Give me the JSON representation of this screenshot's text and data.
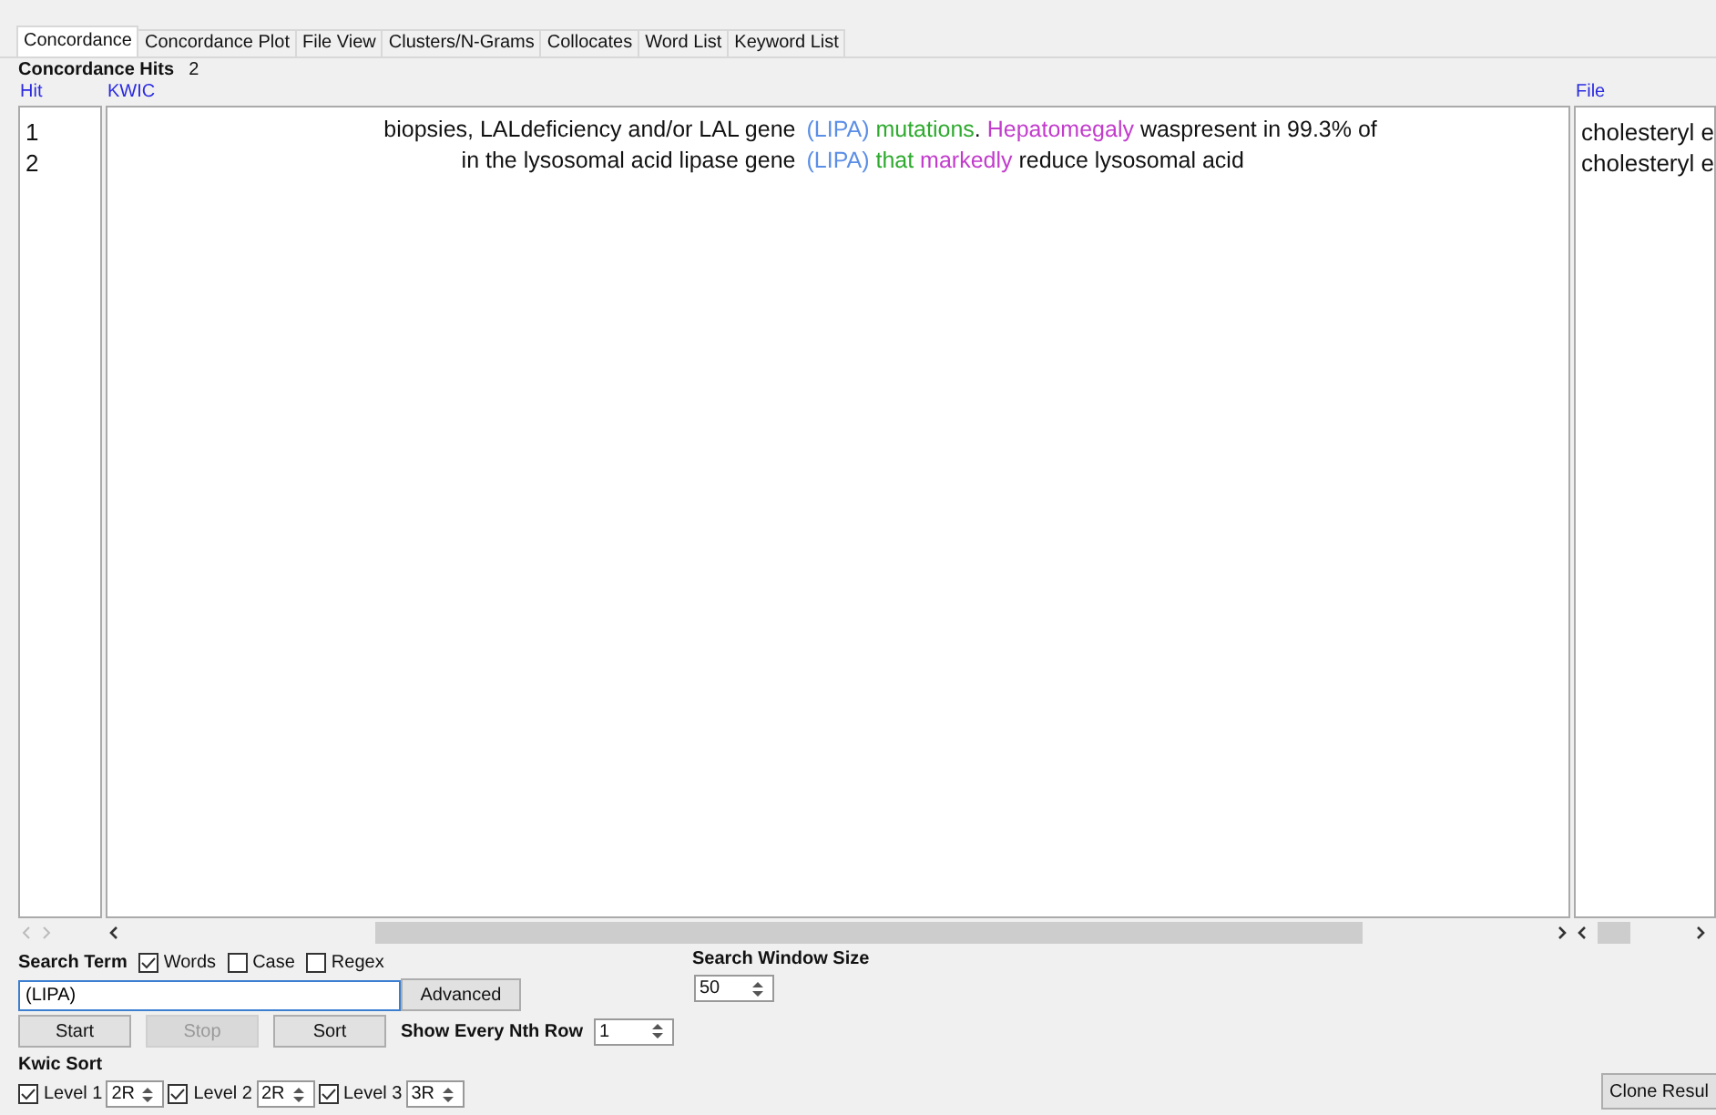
{
  "tabs": [
    {
      "label": "Concordance",
      "selected": true
    },
    {
      "label": "Concordance Plot",
      "selected": false
    },
    {
      "label": "File View",
      "selected": false
    },
    {
      "label": "Clusters/N-Grams",
      "selected": false
    },
    {
      "label": "Collocates",
      "selected": false
    },
    {
      "label": "Word List",
      "selected": false
    },
    {
      "label": "Keyword List",
      "selected": false
    }
  ],
  "hits": {
    "label": "Concordance Hits",
    "count": "2"
  },
  "table": {
    "columns": [
      "Hit",
      "KWIC",
      "File"
    ],
    "rows": [
      {
        "hit": "1",
        "left": "biopsies, LALdeficiency and/or LAL gene",
        "key": {
          "text": "(LIPA)",
          "color": "#5b8ee6"
        },
        "right": [
          {
            "text": " mutations",
            "color": "#2eaa2e"
          },
          {
            "text": "."
          },
          {
            "text": " Hepatomegaly",
            "color": "#c23ccc"
          },
          {
            "text": " waspresent in 99.3% of"
          }
        ],
        "file": "cholesteryl e"
      },
      {
        "hit": "2",
        "left": "in the lysosomal acid lipase gene",
        "key": {
          "text": "(LIPA)",
          "color": "#5b8ee6"
        },
        "right": [
          {
            "text": " that",
            "color": "#2eaa2e"
          },
          {
            "text": " markedly",
            "color": "#c23ccc"
          },
          {
            "text": " reduce lysosomal acid"
          }
        ],
        "file": "cholesteryl e"
      }
    ]
  },
  "search": {
    "label": "Search Term",
    "options": [
      {
        "label": "Words",
        "checked": true
      },
      {
        "label": "Case",
        "checked": false
      },
      {
        "label": "Regex",
        "checked": false
      }
    ],
    "value": "(LIPA)",
    "advanced": "Advanced"
  },
  "buttons": [
    {
      "label": "Start",
      "disabled": false
    },
    {
      "label": "Stop",
      "disabled": true
    },
    {
      "label": "Sort",
      "disabled": false
    }
  ],
  "nth_row": {
    "label": "Show Every Nth Row",
    "value": "1"
  },
  "window_size": {
    "label": "Search Window Size",
    "value": "50"
  },
  "kwic_sort": {
    "label": "Kwic Sort",
    "levels": [
      {
        "label": "Level 1",
        "checked": true,
        "value": "2R"
      },
      {
        "label": "Level 2",
        "checked": true,
        "value": "2R"
      },
      {
        "label": "Level 3",
        "checked": true,
        "value": "3R"
      }
    ]
  },
  "clone_button": "Clone Resul"
}
